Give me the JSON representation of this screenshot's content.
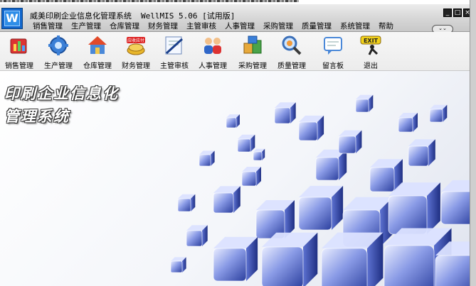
{
  "window": {
    "title": "威美印刷企业信息化管理系统",
    "version": "WellMIS 5.06 [试用版]",
    "logo_letter": "W",
    "controls": [
      "minimize",
      "maximize",
      "close"
    ],
    "ribbon_toggle": "⌄⌄"
  },
  "menu": [
    "销售管理",
    "生产管理",
    "仓库管理",
    "财务管理",
    "主管审核",
    "人事管理",
    "采购管理",
    "质量管理",
    "系统管理",
    "帮助"
  ],
  "toolbar": [
    {
      "label": "销售管理",
      "icon": "sales-chart-icon"
    },
    {
      "label": "生产管理",
      "icon": "gear-production-icon"
    },
    {
      "label": "仓库管理",
      "icon": "warehouse-house-icon"
    },
    {
      "label": "财务管理",
      "icon": "finance-gold-icon",
      "badge": "应收应付"
    },
    {
      "label": "主管审核",
      "icon": "approval-pen-icon"
    },
    {
      "label": "人事管理",
      "icon": "people-group-icon"
    },
    {
      "label": "采购管理",
      "icon": "purchase-boxes-icon"
    },
    {
      "label": "质量管理",
      "icon": "quality-magnifier-icon"
    },
    {
      "label": "留言板",
      "icon": "message-board-icon"
    },
    {
      "label": "退出",
      "icon": "exit-icon",
      "badge": "EXIT"
    }
  ],
  "brand": {
    "line1": "印刷企业信息化",
    "line2": "管理系统"
  },
  "colors": {
    "accent": "#1166cc",
    "cube": "#4a63c8"
  }
}
